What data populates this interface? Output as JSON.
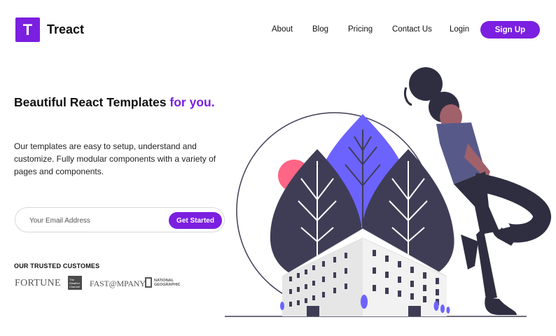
{
  "header": {
    "logo_letter": "T",
    "brand_name": "Treact",
    "nav": [
      "About",
      "Blog",
      "Pricing",
      "Contact Us",
      "Login"
    ],
    "signup_label": "Sign Up"
  },
  "hero": {
    "title_main": "Beautiful React Templates",
    "title_accent": "for you.",
    "description": "Our templates are easy to setup, understand and customize. Fully modular components with a variety of pages and components."
  },
  "signup_form": {
    "email_placeholder": "Your Email Address",
    "button_label": "Get Started"
  },
  "trusted": {
    "heading": "OUR TRUSTED CUSTOMES",
    "logos": {
      "fortune": "FORTUNE",
      "weather": "The Weather Channel",
      "fastco": "FAST@MPANY",
      "natgeo": "NATIONAL GEOGRAPHIC"
    }
  },
  "colors": {
    "accent": "#7b1fe0",
    "illustration_dark": "#3f3d56",
    "illustration_purple": "#6c63ff",
    "illustration_pink": "#ff6584"
  }
}
